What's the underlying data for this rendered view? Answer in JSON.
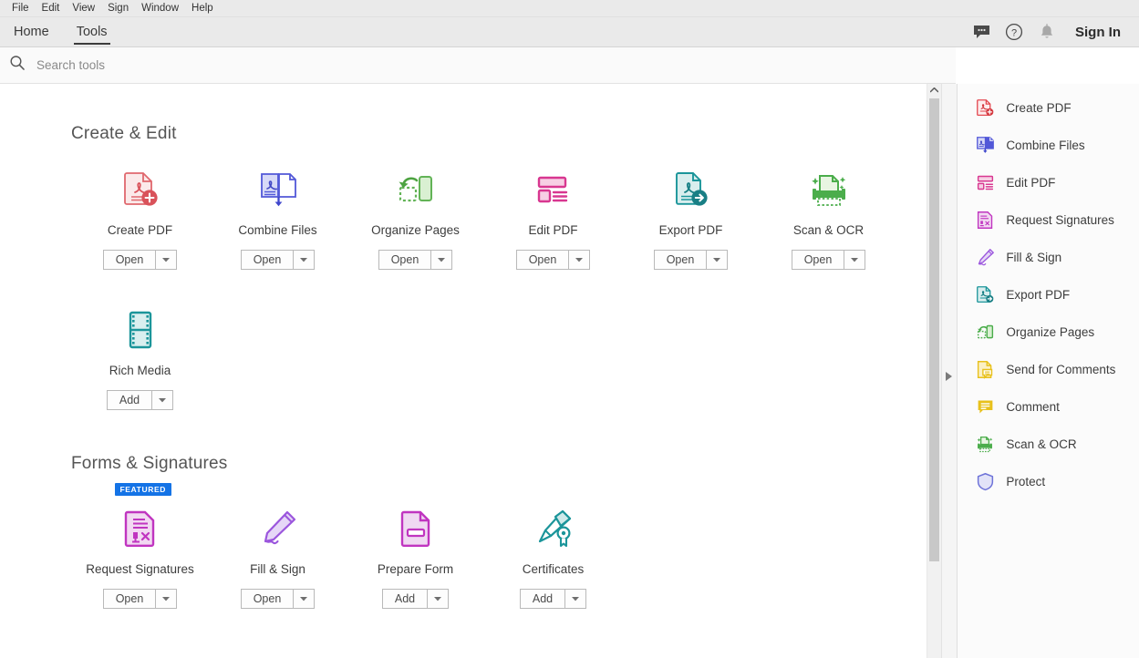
{
  "menubar": {
    "items": [
      {
        "label": "File"
      },
      {
        "label": "Edit"
      },
      {
        "label": "View"
      },
      {
        "label": "Sign"
      },
      {
        "label": "Window"
      },
      {
        "label": "Help"
      }
    ]
  },
  "tabbar": {
    "tabs": [
      {
        "label": "Home",
        "active": false
      },
      {
        "label": "Tools",
        "active": true
      }
    ],
    "comment_icon": "comment-icon",
    "help_icon": "help-icon",
    "bell_icon": "bell-icon",
    "signin_label": "Sign In"
  },
  "search": {
    "icon": "search-icon",
    "placeholder": "Search tools",
    "value": ""
  },
  "sections": [
    {
      "title": "Create & Edit",
      "rows": [
        [
          {
            "label": "Create PDF",
            "icon": "create-pdf-icon",
            "button": "Open",
            "featured": false
          },
          {
            "label": "Combine Files",
            "icon": "combine-files-icon",
            "button": "Open",
            "featured": false
          },
          {
            "label": "Organize Pages",
            "icon": "organize-pages-icon",
            "button": "Open",
            "featured": false
          },
          {
            "label": "Edit PDF",
            "icon": "edit-pdf-icon",
            "button": "Open",
            "featured": false
          },
          {
            "label": "Export PDF",
            "icon": "export-pdf-icon",
            "button": "Open",
            "featured": false
          },
          {
            "label": "Scan & OCR",
            "icon": "scan-ocr-icon",
            "button": "Open",
            "featured": false
          }
        ],
        [
          {
            "label": "Rich Media",
            "icon": "rich-media-icon",
            "button": "Add",
            "featured": false
          }
        ]
      ]
    },
    {
      "title": "Forms & Signatures",
      "rows": [
        [
          {
            "label": "Request Signatures",
            "icon": "request-signatures-icon",
            "button": "Open",
            "featured": true,
            "featured_label": "FEATURED"
          },
          {
            "label": "Fill & Sign",
            "icon": "fill-sign-icon",
            "button": "Open",
            "featured": false
          },
          {
            "label": "Prepare Form",
            "icon": "prepare-form-icon",
            "button": "Add",
            "featured": false
          },
          {
            "label": "Certificates",
            "icon": "certificates-icon",
            "button": "Add",
            "featured": false
          }
        ]
      ]
    }
  ],
  "right_panel": {
    "items": [
      {
        "label": "Create PDF",
        "icon": "create-pdf-icon",
        "color": "#e34850"
      },
      {
        "label": "Combine Files",
        "icon": "combine-files-icon",
        "color": "#5258d8"
      },
      {
        "label": "Edit PDF",
        "icon": "edit-pdf-icon",
        "color": "#d83790"
      },
      {
        "label": "Request Signatures",
        "icon": "request-signatures-icon",
        "color": "#c035c0"
      },
      {
        "label": "Fill & Sign",
        "icon": "fill-sign-icon",
        "color": "#9b56dd"
      },
      {
        "label": "Export PDF",
        "icon": "export-pdf-icon",
        "color": "#1b959a"
      },
      {
        "label": "Organize Pages",
        "icon": "organize-pages-icon",
        "color": "#4bad4b"
      },
      {
        "label": "Send for Comments",
        "icon": "send-for-comments-icon",
        "color": "#e8c11c"
      },
      {
        "label": "Comment",
        "icon": "comment-icon",
        "color": "#e8c11c"
      },
      {
        "label": "Scan & OCR",
        "icon": "scan-ocr-icon",
        "color": "#4bad4b"
      },
      {
        "label": "Protect",
        "icon": "protect-icon",
        "color": "#6d72d8"
      }
    ]
  },
  "scrollbar": {
    "up_arrow_icon": "chevron-up-icon"
  },
  "splitter": {
    "arrow_icon": "triangle-right-icon"
  },
  "colors": {
    "accent_blue": "#1473e6",
    "menubar_bg": "#eaeaea",
    "panel_bg": "#fbfbfb"
  }
}
